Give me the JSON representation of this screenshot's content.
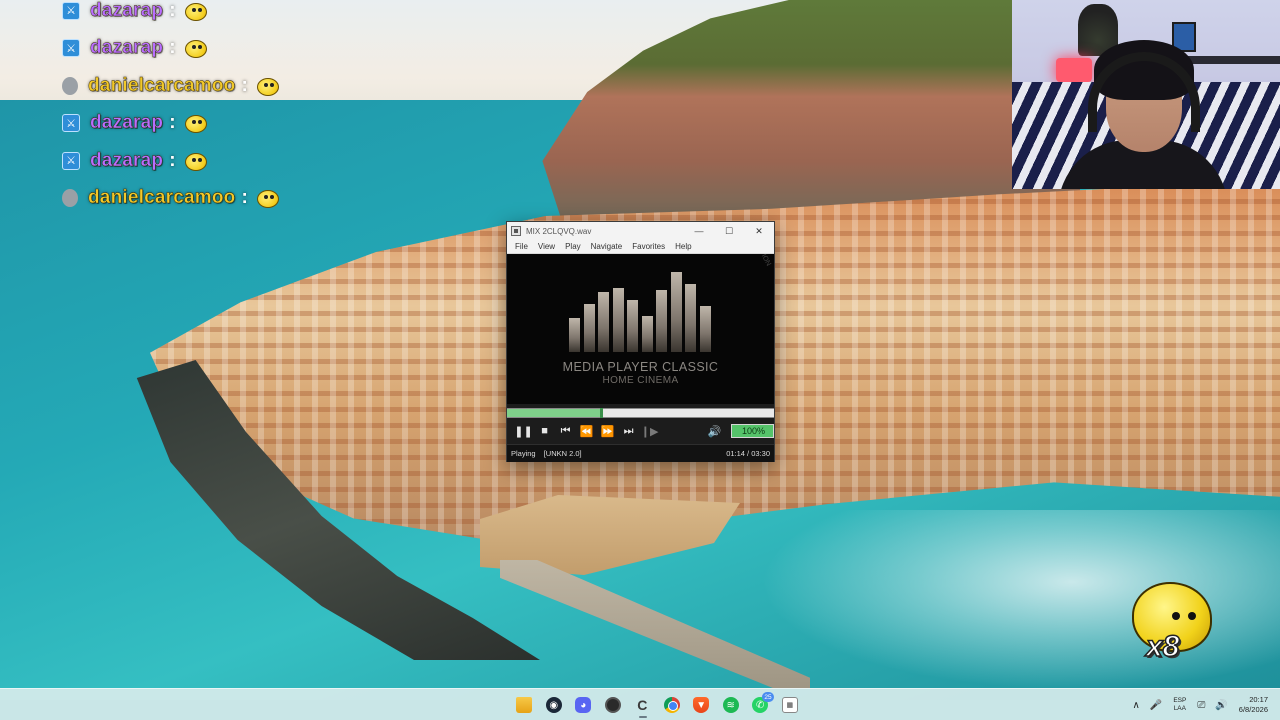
{
  "chat": {
    "messages": [
      {
        "user": "dazarap",
        "sep": ":",
        "badge": "mod",
        "color": "#b86dff"
      },
      {
        "user": "dazarap",
        "sep": ":",
        "badge": "mod",
        "color": "#b86dff"
      },
      {
        "user": "danielcarcamoo",
        "sep": ":",
        "badge": "sub",
        "color": "#f2c92a"
      },
      {
        "user": "dazarap",
        "sep": ":",
        "badge": "mod",
        "color": "#b86dff"
      },
      {
        "user": "dazarap",
        "sep": ":",
        "badge": "mod",
        "color": "#b86dff"
      },
      {
        "user": "danielcarcamoo",
        "sep": ":",
        "badge": "sub",
        "color": "#f2c92a"
      }
    ]
  },
  "player": {
    "title": "MIX 2CLQVQ.wav",
    "window_buttons": {
      "minimize": "—",
      "maximize": "☐",
      "close": "✕"
    },
    "menu": [
      "File",
      "View",
      "Play",
      "Navigate",
      "Favorites",
      "Help"
    ],
    "logo_line1": "MEDIA PLAYER CLASSIC",
    "logo_line2": "HOME CINEMA",
    "logo_edition": "X64 EDITION",
    "progress_fraction": 0.352,
    "volume_label": "100%",
    "status": "Playing",
    "codec": "[UNKN 2.0]",
    "time": "01:14 / 03:30",
    "controls": [
      {
        "name": "pause-button",
        "glyph": "❚❚",
        "disabled": false
      },
      {
        "name": "stop-button",
        "glyph": "■",
        "disabled": false
      },
      {
        "name": "previous-button",
        "glyph": "⏮",
        "disabled": false
      },
      {
        "name": "rewind-button",
        "glyph": "⏪",
        "disabled": false
      },
      {
        "name": "fast-forward-button",
        "glyph": "⏩",
        "disabled": false
      },
      {
        "name": "next-button",
        "glyph": "⏭",
        "disabled": false
      },
      {
        "name": "frame-step-button",
        "glyph": "❙▶",
        "disabled": true
      }
    ],
    "volume_icon": "🔊"
  },
  "taskbar": {
    "apps": [
      {
        "name": "start-icon",
        "kind": "start"
      },
      {
        "name": "file-explorer-icon",
        "kind": "folder"
      },
      {
        "name": "steam-icon",
        "kind": "steam",
        "glyph": "◉"
      },
      {
        "name": "discord-icon",
        "kind": "discord",
        "glyph": "◕"
      },
      {
        "name": "obs-icon",
        "kind": "obs",
        "glyph": ""
      },
      {
        "name": "mpc-taskbar-icon",
        "kind": "c",
        "glyph": "C",
        "active": true
      },
      {
        "name": "chrome-icon",
        "kind": "chrome"
      },
      {
        "name": "brave-icon",
        "kind": "brave",
        "glyph": "▼"
      },
      {
        "name": "spotify-icon",
        "kind": "spotify",
        "glyph": "≋"
      },
      {
        "name": "whatsapp-icon",
        "kind": "whatsapp",
        "glyph": "✆",
        "badge": "25"
      },
      {
        "name": "calendar-icon",
        "kind": "calendar",
        "glyph": "▦"
      }
    ],
    "tray": {
      "chevron": "∧",
      "mic": "🎤",
      "lang_line1": "ESP",
      "lang_line2": "LAA",
      "network": "⎚",
      "volume": "🔊",
      "time": "20:17",
      "date": "6/8/2026"
    }
  },
  "alert": {
    "count": "x8"
  }
}
